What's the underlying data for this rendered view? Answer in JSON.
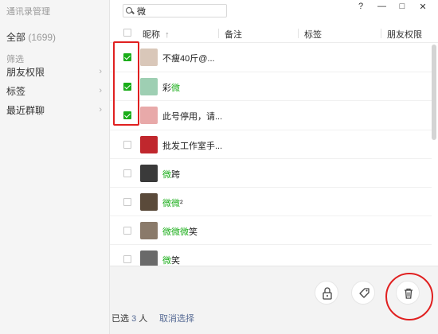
{
  "app_title": "通讯录管理",
  "sidebar": {
    "all_label": "全部",
    "all_count": "(1699)",
    "filter_heading": "筛选",
    "items": [
      {
        "label": "朋友权限"
      },
      {
        "label": "标签"
      },
      {
        "label": "最近群聊"
      }
    ]
  },
  "search": {
    "value": "微"
  },
  "window_controls": {
    "help": "?",
    "minimize": "—",
    "maximize": "□",
    "close": "✕"
  },
  "table": {
    "headers": {
      "nickname": "昵称",
      "sort_indicator": "↑",
      "remark": "备注",
      "tag": "标签",
      "permission": "朋友权限"
    },
    "rows": [
      {
        "name_pre": "不瘦40斤@...",
        "name_hl": "",
        "name_post": "",
        "checked": true,
        "avatar_color": "#d9c7b9"
      },
      {
        "name_pre": "彩",
        "name_hl": "微",
        "name_post": "",
        "checked": true,
        "avatar_color": "#9ecfb3"
      },
      {
        "name_pre": "此号停用，请...",
        "name_hl": "",
        "name_post": "",
        "checked": true,
        "avatar_color": "#e8a9a9"
      },
      {
        "name_pre": "批发工作室手...",
        "name_hl": "",
        "name_post": "",
        "checked": false,
        "avatar_color": "#c0272d"
      },
      {
        "name_pre": "",
        "name_hl": "微",
        "name_post": "跨",
        "checked": false,
        "avatar_color": "#3a3a3a"
      },
      {
        "name_pre": "",
        "name_hl": "微微",
        "name_post": "²",
        "checked": false,
        "avatar_color": "#5a4a3a"
      },
      {
        "name_pre": "",
        "name_hl": "微微微",
        "name_post": "笑",
        "checked": false,
        "avatar_color": "#8a7a6a"
      },
      {
        "name_pre": "",
        "name_hl": "微",
        "name_post": "笑",
        "checked": false,
        "avatar_color": "#6a6a6a"
      }
    ]
  },
  "footer": {
    "selected_prefix": "已选",
    "selected_count": "3",
    "selected_unit": "人",
    "clear_label": "取消选择",
    "actions": [
      {
        "icon": "lock-icon"
      },
      {
        "icon": "tag-icon"
      },
      {
        "icon": "trash-icon"
      }
    ]
  },
  "colors": {
    "accent_green": "#1aad19",
    "link_blue": "#576b95",
    "annotation_red": "#e02020"
  }
}
